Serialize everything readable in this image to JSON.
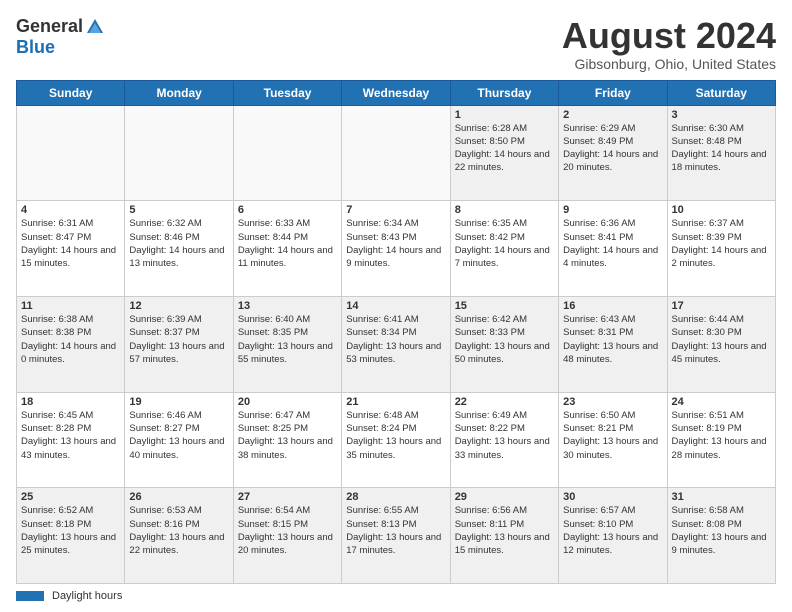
{
  "header": {
    "logo": {
      "general": "General",
      "blue": "Blue"
    },
    "title": "August 2024",
    "location": "Gibsonburg, Ohio, United States"
  },
  "days_of_week": [
    "Sunday",
    "Monday",
    "Tuesday",
    "Wednesday",
    "Thursday",
    "Friday",
    "Saturday"
  ],
  "footer": {
    "legend_label": "Daylight hours"
  },
  "weeks": [
    [
      {
        "day": "",
        "empty": true
      },
      {
        "day": "",
        "empty": true
      },
      {
        "day": "",
        "empty": true
      },
      {
        "day": "",
        "empty": true
      },
      {
        "day": "1",
        "sunrise": "6:28 AM",
        "sunset": "8:50 PM",
        "daylight": "14 hours and 22 minutes."
      },
      {
        "day": "2",
        "sunrise": "6:29 AM",
        "sunset": "8:49 PM",
        "daylight": "14 hours and 20 minutes."
      },
      {
        "day": "3",
        "sunrise": "6:30 AM",
        "sunset": "8:48 PM",
        "daylight": "14 hours and 18 minutes."
      }
    ],
    [
      {
        "day": "4",
        "sunrise": "6:31 AM",
        "sunset": "8:47 PM",
        "daylight": "14 hours and 15 minutes."
      },
      {
        "day": "5",
        "sunrise": "6:32 AM",
        "sunset": "8:46 PM",
        "daylight": "14 hours and 13 minutes."
      },
      {
        "day": "6",
        "sunrise": "6:33 AM",
        "sunset": "8:44 PM",
        "daylight": "14 hours and 11 minutes."
      },
      {
        "day": "7",
        "sunrise": "6:34 AM",
        "sunset": "8:43 PM",
        "daylight": "14 hours and 9 minutes."
      },
      {
        "day": "8",
        "sunrise": "6:35 AM",
        "sunset": "8:42 PM",
        "daylight": "14 hours and 7 minutes."
      },
      {
        "day": "9",
        "sunrise": "6:36 AM",
        "sunset": "8:41 PM",
        "daylight": "14 hours and 4 minutes."
      },
      {
        "day": "10",
        "sunrise": "6:37 AM",
        "sunset": "8:39 PM",
        "daylight": "14 hours and 2 minutes."
      }
    ],
    [
      {
        "day": "11",
        "sunrise": "6:38 AM",
        "sunset": "8:38 PM",
        "daylight": "14 hours and 0 minutes."
      },
      {
        "day": "12",
        "sunrise": "6:39 AM",
        "sunset": "8:37 PM",
        "daylight": "13 hours and 57 minutes."
      },
      {
        "day": "13",
        "sunrise": "6:40 AM",
        "sunset": "8:35 PM",
        "daylight": "13 hours and 55 minutes."
      },
      {
        "day": "14",
        "sunrise": "6:41 AM",
        "sunset": "8:34 PM",
        "daylight": "13 hours and 53 minutes."
      },
      {
        "day": "15",
        "sunrise": "6:42 AM",
        "sunset": "8:33 PM",
        "daylight": "13 hours and 50 minutes."
      },
      {
        "day": "16",
        "sunrise": "6:43 AM",
        "sunset": "8:31 PM",
        "daylight": "13 hours and 48 minutes."
      },
      {
        "day": "17",
        "sunrise": "6:44 AM",
        "sunset": "8:30 PM",
        "daylight": "13 hours and 45 minutes."
      }
    ],
    [
      {
        "day": "18",
        "sunrise": "6:45 AM",
        "sunset": "8:28 PM",
        "daylight": "13 hours and 43 minutes."
      },
      {
        "day": "19",
        "sunrise": "6:46 AM",
        "sunset": "8:27 PM",
        "daylight": "13 hours and 40 minutes."
      },
      {
        "day": "20",
        "sunrise": "6:47 AM",
        "sunset": "8:25 PM",
        "daylight": "13 hours and 38 minutes."
      },
      {
        "day": "21",
        "sunrise": "6:48 AM",
        "sunset": "8:24 PM",
        "daylight": "13 hours and 35 minutes."
      },
      {
        "day": "22",
        "sunrise": "6:49 AM",
        "sunset": "8:22 PM",
        "daylight": "13 hours and 33 minutes."
      },
      {
        "day": "23",
        "sunrise": "6:50 AM",
        "sunset": "8:21 PM",
        "daylight": "13 hours and 30 minutes."
      },
      {
        "day": "24",
        "sunrise": "6:51 AM",
        "sunset": "8:19 PM",
        "daylight": "13 hours and 28 minutes."
      }
    ],
    [
      {
        "day": "25",
        "sunrise": "6:52 AM",
        "sunset": "8:18 PM",
        "daylight": "13 hours and 25 minutes."
      },
      {
        "day": "26",
        "sunrise": "6:53 AM",
        "sunset": "8:16 PM",
        "daylight": "13 hours and 22 minutes."
      },
      {
        "day": "27",
        "sunrise": "6:54 AM",
        "sunset": "8:15 PM",
        "daylight": "13 hours and 20 minutes."
      },
      {
        "day": "28",
        "sunrise": "6:55 AM",
        "sunset": "8:13 PM",
        "daylight": "13 hours and 17 minutes."
      },
      {
        "day": "29",
        "sunrise": "6:56 AM",
        "sunset": "8:11 PM",
        "daylight": "13 hours and 15 minutes."
      },
      {
        "day": "30",
        "sunrise": "6:57 AM",
        "sunset": "8:10 PM",
        "daylight": "13 hours and 12 minutes."
      },
      {
        "day": "31",
        "sunrise": "6:58 AM",
        "sunset": "8:08 PM",
        "daylight": "13 hours and 9 minutes."
      }
    ]
  ]
}
